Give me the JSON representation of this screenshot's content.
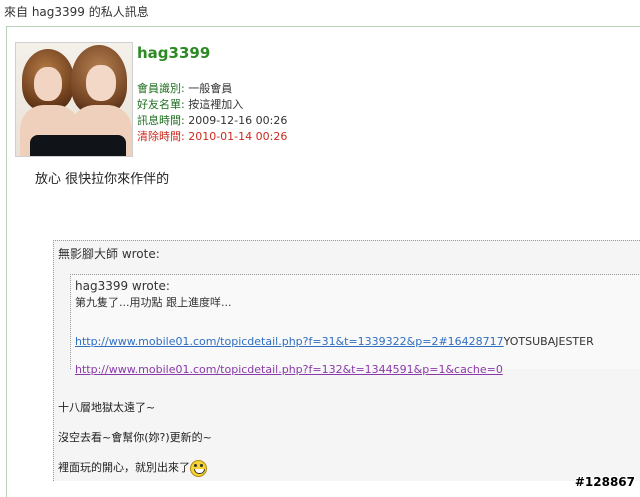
{
  "page": {
    "header": "來自 hag3399 的私人訊息"
  },
  "sender": {
    "username": "hag3399",
    "fields": [
      {
        "label": "會員識別:",
        "value": "一般會員",
        "style": "normal"
      },
      {
        "label": "好友名單:",
        "value": "按這裡加入",
        "style": "normal"
      },
      {
        "label": "訊息時間:",
        "value": "2009-12-16 00:26",
        "style": "normal"
      },
      {
        "label": "清除時間:",
        "value": "2010-01-14 00:26",
        "style": "red"
      }
    ]
  },
  "message": {
    "text": "放心 很快拉你來作伴的"
  },
  "quote_outer": {
    "header": "無影腳大師 wrote:",
    "lines": [
      "十八層地獄太遠了~",
      "沒空去看~會幫你(妳?)更新的~",
      "裡面玩的開心，就別出來了"
    ]
  },
  "quote_inner": {
    "header": "hag3399 wrote:",
    "text": "第九隻了...用功點 跟上進度咩...",
    "link1": "http://www.mobile01.com/topicdetail.php?f=31&t=1339322&p=2#16428717",
    "link1_tail": "YOTSUBAJESTER",
    "link2": "http://www.mobile01.com/topicdetail.php?f=132&t=1344591&p=1&cache=0"
  },
  "watermark": "#128867",
  "icons": {
    "avatar": "avatar-photo",
    "smiley": "grin-smiley-icon"
  }
}
